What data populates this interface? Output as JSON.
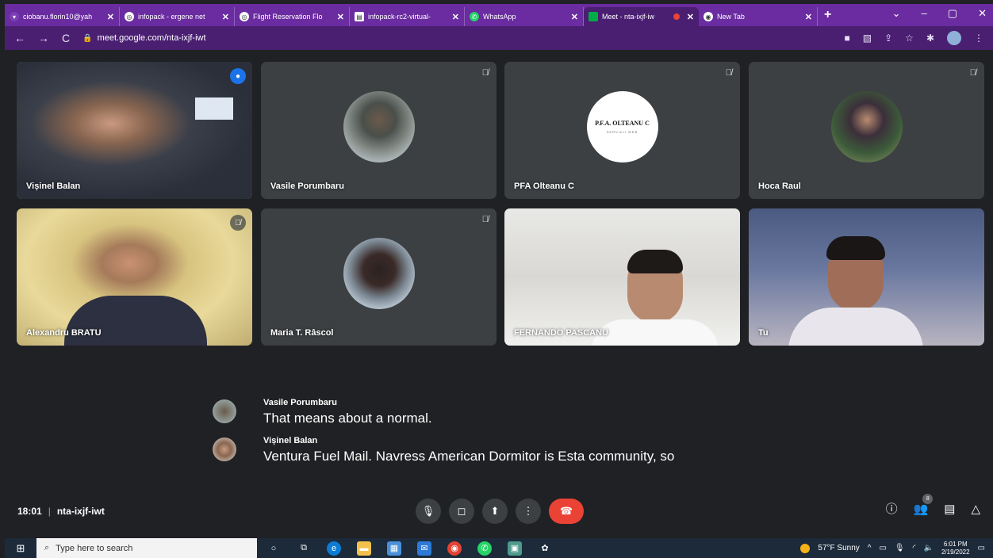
{
  "browser": {
    "tabs": [
      {
        "label": "ciobanu.florin10@yah",
        "icon": "yahoo-mail-icon",
        "active": false
      },
      {
        "label": "infopack - ergene net",
        "icon": "globe-icon",
        "active": false
      },
      {
        "label": "Flight Reservation Flo",
        "icon": "globe-icon",
        "active": false
      },
      {
        "label": "infopack-rc2-virtual-",
        "icon": "document-icon",
        "active": false
      },
      {
        "label": "WhatsApp",
        "icon": "whatsapp-icon",
        "active": false
      },
      {
        "label": "Meet - nta-ixjf-iw",
        "icon": "meet-icon",
        "active": true
      },
      {
        "label": "New Tab",
        "icon": "chrome-icon",
        "active": false
      }
    ],
    "url": "meet.google.com/nta-ixjf-iwt",
    "accent": "#6a2ca0"
  },
  "participants": [
    {
      "name": "Vișinel Balan",
      "type": "video",
      "speaking": true
    },
    {
      "name": "Vasile Porumbaru",
      "type": "avatar",
      "muted": true
    },
    {
      "name": "PFA Olteanu C",
      "type": "logo",
      "muted": true,
      "logo_text": "P.F.A. OLTEANU C",
      "logo_sub": "SERVICII WEB"
    },
    {
      "name": "Hoca Raul",
      "type": "avatar",
      "muted": true
    },
    {
      "name": "Alexandru BRATU",
      "type": "video",
      "muted": true
    },
    {
      "name": "Maria T. Râscol",
      "type": "avatar",
      "muted": true
    },
    {
      "name": "FERNANDO PASCANU",
      "type": "video"
    },
    {
      "name": "Tu",
      "type": "video"
    }
  ],
  "captions": [
    {
      "speaker": "Vasile Porumbaru",
      "text": "That means about a normal."
    },
    {
      "speaker": "Vișinel Balan",
      "text": "Ventura Fuel Mail. Navress American Dormitor is Esta community, so"
    }
  ],
  "meeting": {
    "time": "18:01",
    "divider": "|",
    "code": "nta-ixjf-iwt",
    "participant_count": "8",
    "end_call_color": "#ea4335"
  },
  "taskbar": {
    "search_placeholder": "Type here to search",
    "weather": "57°F Sunny",
    "clock_time": "6:01 PM",
    "clock_date": "2/19/2022"
  }
}
